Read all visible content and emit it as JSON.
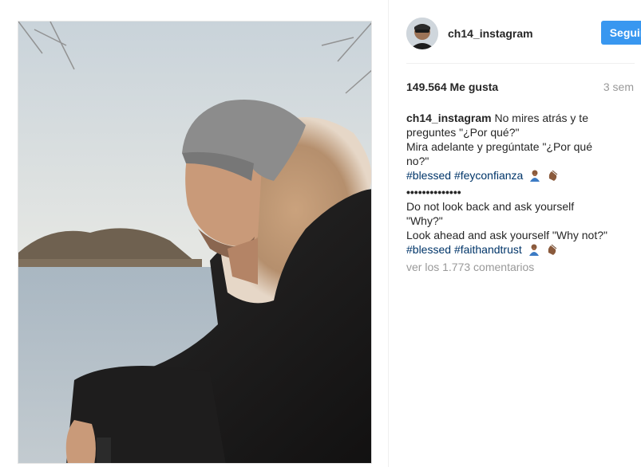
{
  "post": {
    "username": "ch14_instagram",
    "follow_label": "Seguir",
    "likes": "149.564 Me gusta",
    "age": "3 sem",
    "caption": {
      "user": "ch14_instagram",
      "line1": "No mires atrás y te",
      "line2": "preguntes \"¿Por qué?\"",
      "line3": "Mira adelante y pregúntate \"¿Por qué",
      "line4": "no?\"",
      "tag1": "#blessed",
      "tag2": "#feyconfianza",
      "separator": "••••••••••••••",
      "line5": "Do not look back and ask yourself",
      "line6": "\"Why?\"",
      "line7": "Look ahead and ask yourself \"Why not?\"",
      "tag3": "#blessed",
      "tag4": "#faithandtrust",
      "emoji_1": "person-praying-emoji",
      "emoji_2": "clapping-hand-emoji"
    },
    "comments_link": "ver los 1.773 comentarios"
  },
  "colors": {
    "follow_button": "#3897f0",
    "hashtag": "#003569",
    "muted_text": "#999999",
    "text": "#262626"
  }
}
